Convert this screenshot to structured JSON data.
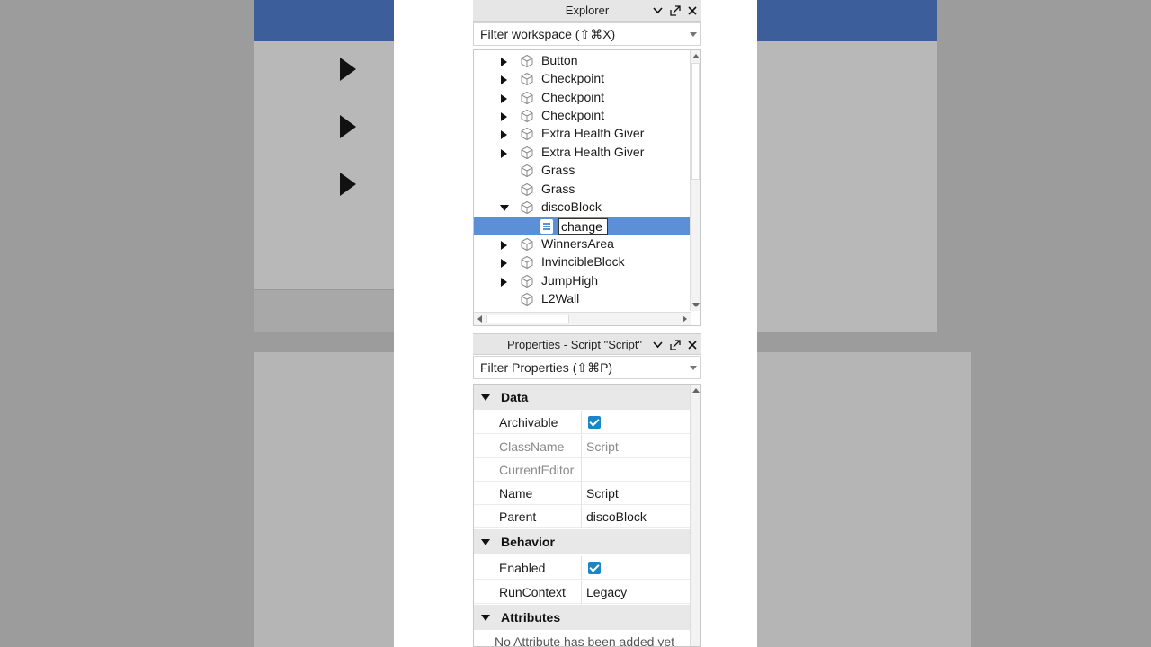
{
  "explorer": {
    "title": "Explorer",
    "filter_placeholder": "Filter workspace (⇧⌘X)",
    "items": [
      {
        "label": "Button",
        "expander": "collapsed"
      },
      {
        "label": "Checkpoint",
        "expander": "collapsed"
      },
      {
        "label": "Checkpoint",
        "expander": "collapsed"
      },
      {
        "label": "Checkpoint",
        "expander": "collapsed"
      },
      {
        "label": "Extra Health Giver",
        "expander": "collapsed"
      },
      {
        "label": "Extra Health Giver",
        "expander": "collapsed"
      },
      {
        "label": "Grass",
        "expander": "none"
      },
      {
        "label": "Grass",
        "expander": "none"
      },
      {
        "label": "discoBlock",
        "expander": "expanded"
      },
      {
        "label": "",
        "expander": "none",
        "child": true,
        "editing_value": "change"
      },
      {
        "label": "WinnersArea",
        "expander": "collapsed"
      },
      {
        "label": "InvincibleBlock",
        "expander": "collapsed"
      },
      {
        "label": "JumpHigh",
        "expander": "collapsed"
      },
      {
        "label": "L2Wall",
        "expander": "none"
      }
    ]
  },
  "properties": {
    "title": "Properties - Script \"Script\"",
    "filter_placeholder": "Filter Properties (⇧⌘P)",
    "categories": {
      "data": "Data",
      "behavior": "Behavior",
      "attributes": "Attributes"
    },
    "rows": {
      "archivable": {
        "name": "Archivable",
        "checked": true
      },
      "classname": {
        "name": "ClassName",
        "value": "Script"
      },
      "currenteditor": {
        "name": "CurrentEditor",
        "value": ""
      },
      "name": {
        "name": "Name",
        "value": "Script"
      },
      "parent": {
        "name": "Parent",
        "value": "discoBlock"
      },
      "enabled": {
        "name": "Enabled",
        "checked": true
      },
      "runcontext": {
        "name": "RunContext",
        "value": "Legacy"
      }
    },
    "no_attributes": "No Attribute has been added yet"
  },
  "colors": {
    "selection": "#5b8fd6",
    "checkbox": "#1a86c8",
    "header": "#e6e6e6"
  }
}
